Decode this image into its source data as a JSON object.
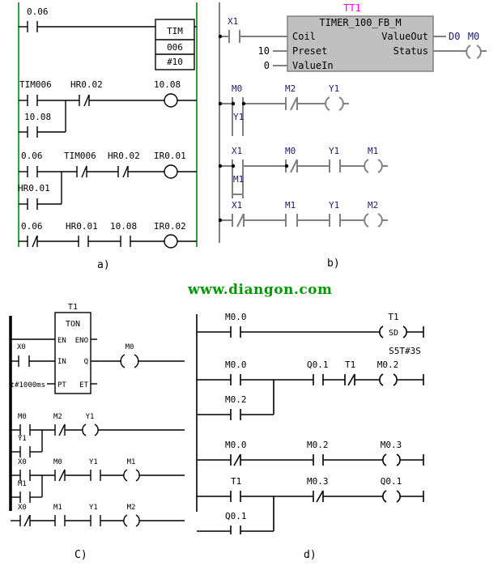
{
  "page": {
    "watermark": "www.diangon.com",
    "panel_labels": {
      "a": "a)",
      "b": "b)",
      "c": "C)",
      "d": "d)"
    }
  },
  "colors": {
    "rail_green": "#3a9a3a",
    "wire_black": "#000000",
    "wire_gray": "#808080",
    "fb_fill": "#c0c0c0",
    "fb_title": "#ff00ff",
    "label_navy": "#1a1a6e",
    "watermark_green": "#009900"
  },
  "panel_a": {
    "title": "a)",
    "style": "omron",
    "rungs": [
      {
        "id": "a-rung-1",
        "contacts": [
          {
            "label": "0.06",
            "type": "NO"
          }
        ],
        "block": {
          "name": "TIM",
          "number": "006",
          "preset": "#10"
        }
      },
      {
        "id": "a-rung-2",
        "contacts": [
          {
            "label": "TIM006",
            "type": "NO"
          },
          {
            "label": "HR0.02",
            "type": "NC"
          }
        ],
        "branch": [
          {
            "label": "10.08",
            "type": "NO"
          }
        ],
        "coil": {
          "label": "10.08",
          "type": "coil"
        }
      },
      {
        "id": "a-rung-3",
        "contacts": [
          {
            "label": "0.06",
            "type": "NO"
          },
          {
            "label": "TIM006",
            "type": "NC"
          },
          {
            "label": "HR0.02",
            "type": "NC"
          }
        ],
        "branch": [
          {
            "label": "HR0.01",
            "type": "NO"
          }
        ],
        "coil": {
          "label": "IR0.01",
          "type": "coil"
        }
      },
      {
        "id": "a-rung-4",
        "contacts": [
          {
            "label": "0.06",
            "type": "NC"
          },
          {
            "label": "HR0.01",
            "type": "NO"
          },
          {
            "label": "10.08",
            "type": "NO"
          }
        ],
        "coil": {
          "label": "IR0.02",
          "type": "coil"
        }
      }
    ]
  },
  "panel_b": {
    "title": "b)",
    "style": "function-block",
    "fb": {
      "instance": "TT1",
      "type": "TIMER_100_FB_M",
      "inputs": [
        {
          "name": "Coil",
          "value": ""
        },
        {
          "name": "Preset",
          "value": "10"
        },
        {
          "name": "ValueIn",
          "value": "0"
        }
      ],
      "outputs": [
        {
          "name": "ValueOut",
          "value": "D0"
        },
        {
          "name": "Status",
          "value": ""
        }
      ],
      "enable_contact": {
        "label": "X1",
        "type": "NO"
      },
      "status_coil": {
        "label": "M0",
        "type": "coil"
      }
    },
    "rungs": [
      {
        "id": "b-rung-2",
        "contacts": [
          {
            "label": "M0",
            "type": "NO"
          },
          {
            "label": "M2",
            "type": "NC"
          }
        ],
        "branch": [
          {
            "label": "Y1",
            "type": "NO"
          }
        ],
        "coil": {
          "label": "Y1",
          "type": "coil"
        }
      },
      {
        "id": "b-rung-3",
        "contacts": [
          {
            "label": "X1",
            "type": "NO"
          },
          {
            "label": "M0",
            "type": "NC"
          },
          {
            "label": "Y1",
            "type": "NO"
          }
        ],
        "branch": [
          {
            "label": "M1",
            "type": "NO"
          }
        ],
        "coil": {
          "label": "M1",
          "type": "coil"
        }
      },
      {
        "id": "b-rung-4",
        "contacts": [
          {
            "label": "X1",
            "type": "NC"
          },
          {
            "label": "M1",
            "type": "NO"
          },
          {
            "label": "Y1",
            "type": "NO"
          }
        ],
        "coil": {
          "label": "M2",
          "type": "coil"
        }
      }
    ]
  },
  "panel_c": {
    "title": "C)",
    "style": "iec-ton",
    "fb": {
      "instance": "T1",
      "type": "TON",
      "left_pins": [
        "EN",
        "IN",
        "PT"
      ],
      "right_pins": [
        "ENO",
        "Q",
        "ET"
      ],
      "in_contact": {
        "label": "X0",
        "type": "NO"
      },
      "pt_value": "t#1000ms",
      "q_coil": {
        "label": "M0",
        "type": "coil"
      }
    },
    "rungs": [
      {
        "id": "c-rung-2",
        "contacts": [
          {
            "label": "M0",
            "type": "NO"
          },
          {
            "label": "M2",
            "type": "NC"
          }
        ],
        "branch": [
          {
            "label": "Y1",
            "type": "NO"
          }
        ],
        "coil": {
          "label": "Y1",
          "type": "coil"
        }
      },
      {
        "id": "c-rung-3",
        "contacts": [
          {
            "label": "X0",
            "type": "NO"
          },
          {
            "label": "M0",
            "type": "NC"
          },
          {
            "label": "Y1",
            "type": "NO"
          }
        ],
        "branch": [
          {
            "label": "M1",
            "type": "NO"
          }
        ],
        "coil": {
          "label": "M1",
          "type": "coil"
        }
      },
      {
        "id": "c-rung-4",
        "contacts": [
          {
            "label": "X0",
            "type": "NC"
          },
          {
            "label": "M1",
            "type": "NO"
          },
          {
            "label": "Y1",
            "type": "NO"
          }
        ],
        "coil": {
          "label": "M2",
          "type": "coil"
        }
      }
    ]
  },
  "panel_d": {
    "title": "d)",
    "style": "siemens",
    "rungs": [
      {
        "id": "d-rung-1",
        "contacts": [
          {
            "label": "M0.0",
            "type": "NO"
          }
        ],
        "coil": {
          "label": "T1",
          "type": "SD",
          "inner": "SD"
        }
      },
      {
        "id": "d-rung-2",
        "preset_label": "S5T#3S",
        "contacts": [
          {
            "label": "M0.0",
            "type": "NO"
          },
          {
            "label": "Q0.1",
            "type": "NO"
          },
          {
            "label": "T1",
            "type": "NC"
          }
        ],
        "branch": [
          {
            "label": "M0.2",
            "type": "NO"
          }
        ],
        "coil": {
          "label": "M0.2",
          "type": "coil"
        }
      },
      {
        "id": "d-rung-3",
        "contacts": [
          {
            "label": "M0.0",
            "type": "NC"
          },
          {
            "label": "M0.2",
            "type": "NO"
          }
        ],
        "coil": {
          "label": "M0.3",
          "type": "coil"
        }
      },
      {
        "id": "d-rung-4",
        "contacts": [
          {
            "label": "T1",
            "type": "NO"
          },
          {
            "label": "M0.3",
            "type": "NC"
          }
        ],
        "branch": [
          {
            "label": "Q0.1",
            "type": "NO"
          }
        ],
        "coil": {
          "label": "Q0.1",
          "type": "coil"
        }
      }
    ]
  }
}
